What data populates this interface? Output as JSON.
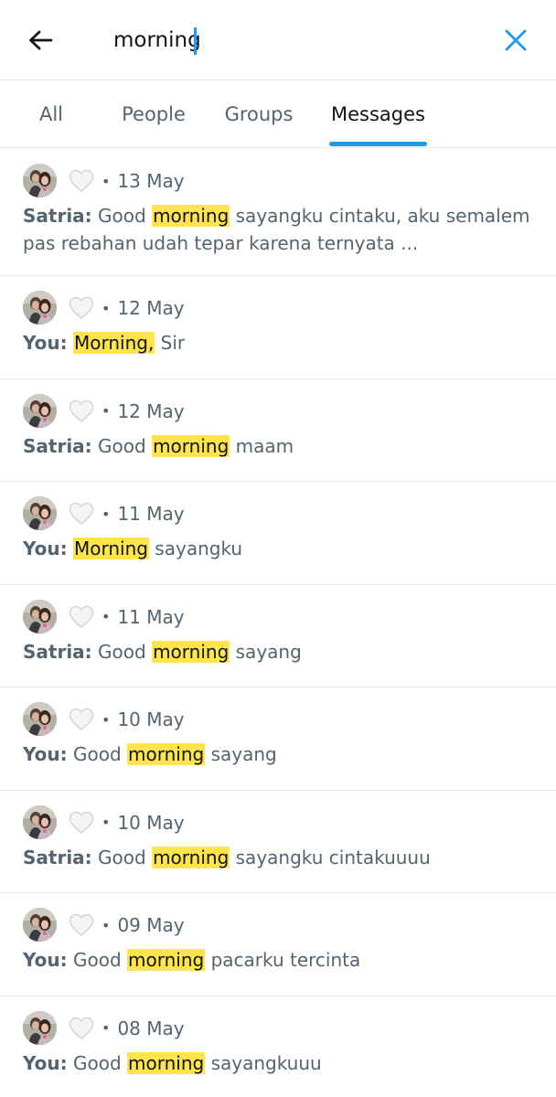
{
  "search": {
    "query": "morning"
  },
  "tabs": [
    {
      "label": "All"
    },
    {
      "label": "People"
    },
    {
      "label": "Groups"
    },
    {
      "label": "Messages",
      "active": true
    }
  ],
  "colors": {
    "accent": "#1d9bf0",
    "highlight": "#ffe44d",
    "secondary_text": "#536471"
  },
  "results": [
    {
      "date": "13 May",
      "sender": "Satria:",
      "before": " Good ",
      "match": "morning",
      "after": " sayangku cintaku, aku semalem pas rebahan udah tepar karena ternyata ..."
    },
    {
      "date": "12 May",
      "sender": "You:",
      "before": " ",
      "match": "Morning,",
      "after": " Sir"
    },
    {
      "date": "12 May",
      "sender": "Satria:",
      "before": " Good ",
      "match": "morning",
      "after": " maam"
    },
    {
      "date": "11 May",
      "sender": "You:",
      "before": " ",
      "match": "Morning",
      "after": " sayangku"
    },
    {
      "date": "11 May",
      "sender": "Satria:",
      "before": " Good ",
      "match": "morning",
      "after": " sayang"
    },
    {
      "date": "10 May",
      "sender": "You:",
      "before": " Good ",
      "match": "morning",
      "after": " sayang"
    },
    {
      "date": "10 May",
      "sender": "Satria:",
      "before": " Good ",
      "match": "morning",
      "after": " sayangku cintakuuuu"
    },
    {
      "date": "09 May",
      "sender": "You:",
      "before": " Good ",
      "match": "morning",
      "after": " pacarku tercinta"
    },
    {
      "date": "08 May",
      "sender": "You:",
      "before": " Good ",
      "match": "morning",
      "after": " sayangkuuu"
    }
  ],
  "icons": {
    "back": "arrow-left-icon",
    "close": "close-x-icon",
    "reaction": "white-heart-icon",
    "avatar": "couple-photo-avatar"
  }
}
